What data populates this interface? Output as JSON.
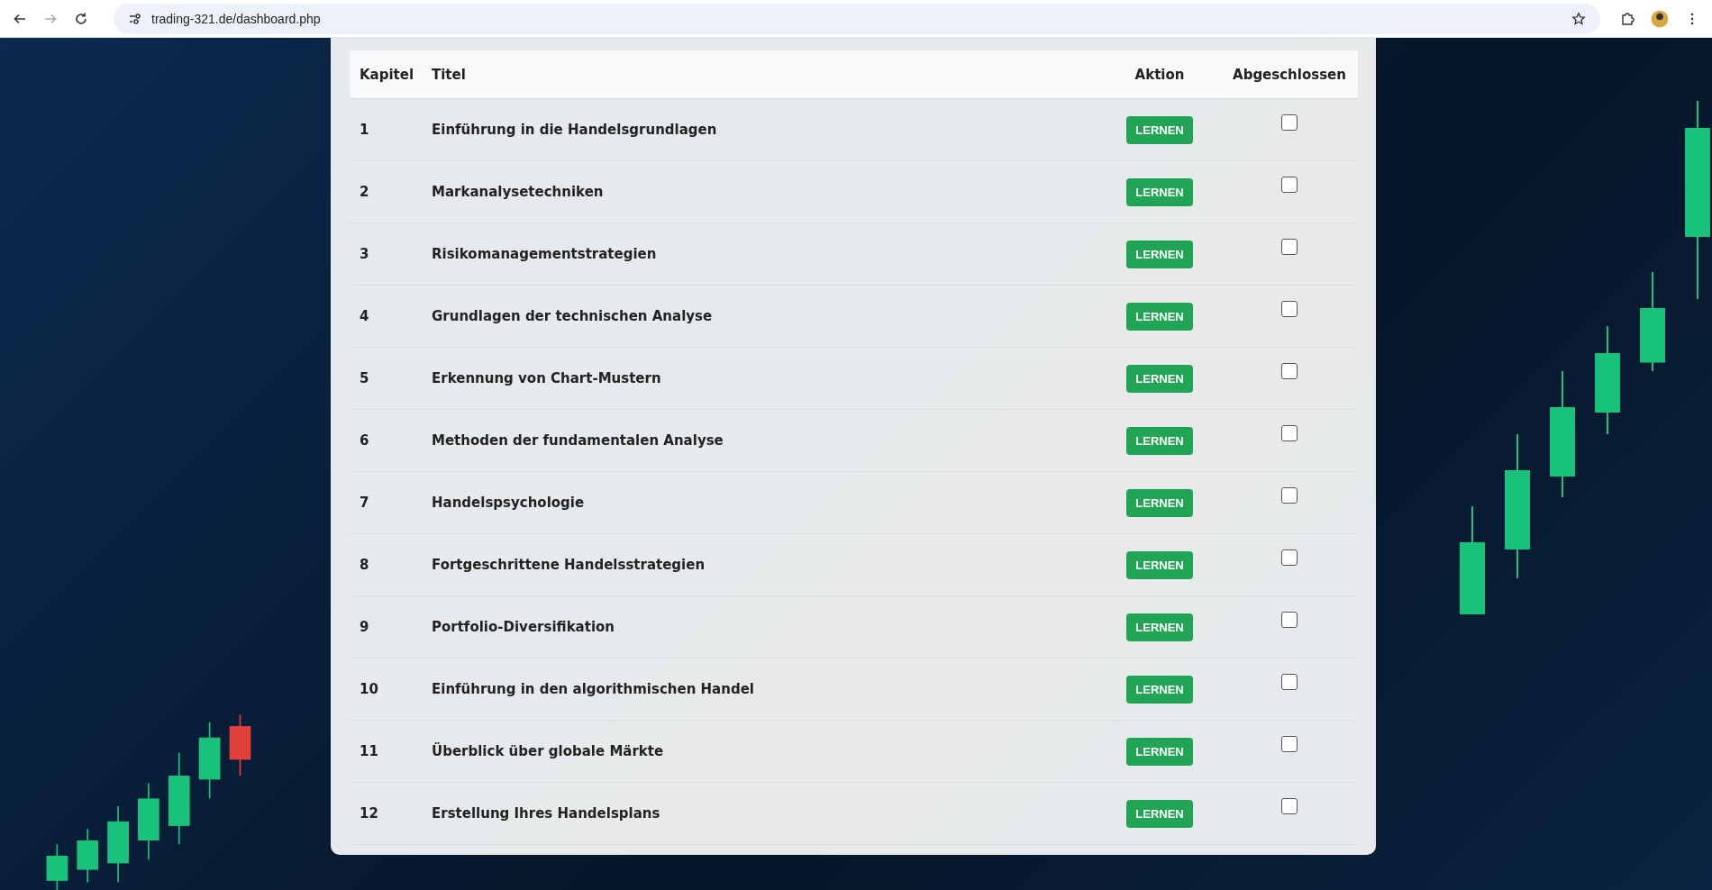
{
  "browser": {
    "url": "trading-321.de/dashboard.php"
  },
  "table": {
    "columns": [
      "Kapitel",
      "Titel",
      "Aktion",
      "Abgeschlossen"
    ],
    "rows": [
      {
        "chapter": "1",
        "title": "Einführung in die Handelsgrundlagen",
        "action": "LERNEN",
        "checked": false
      },
      {
        "chapter": "2",
        "title": "Markanalysetechniken",
        "action": "LERNEN",
        "checked": false
      },
      {
        "chapter": "3",
        "title": "Risikomanagementstrategien",
        "action": "LERNEN",
        "checked": false
      },
      {
        "chapter": "4",
        "title": "Grundlagen der technischen Analyse",
        "action": "LERNEN",
        "checked": false
      },
      {
        "chapter": "5",
        "title": "Erkennung von Chart-Mustern",
        "action": "LERNEN",
        "checked": false
      },
      {
        "chapter": "6",
        "title": "Methoden der fundamentalen Analyse",
        "action": "LERNEN",
        "checked": false
      },
      {
        "chapter": "7",
        "title": "Handelspsychologie",
        "action": "LERNEN",
        "checked": false
      },
      {
        "chapter": "8",
        "title": "Fortgeschrittene Handelsstrategien",
        "action": "LERNEN",
        "checked": false
      },
      {
        "chapter": "9",
        "title": "Portfolio-Diversifikation",
        "action": "LERNEN",
        "checked": false
      },
      {
        "chapter": "10",
        "title": "Einführung in den algorithmischen Handel",
        "action": "LERNEN",
        "checked": false
      },
      {
        "chapter": "11",
        "title": "Überblick über globale Märkte",
        "action": "LERNEN",
        "checked": false
      },
      {
        "chapter": "12",
        "title": "Erstellung Ihres Handelsplans",
        "action": "LERNEN",
        "checked": false
      }
    ]
  }
}
